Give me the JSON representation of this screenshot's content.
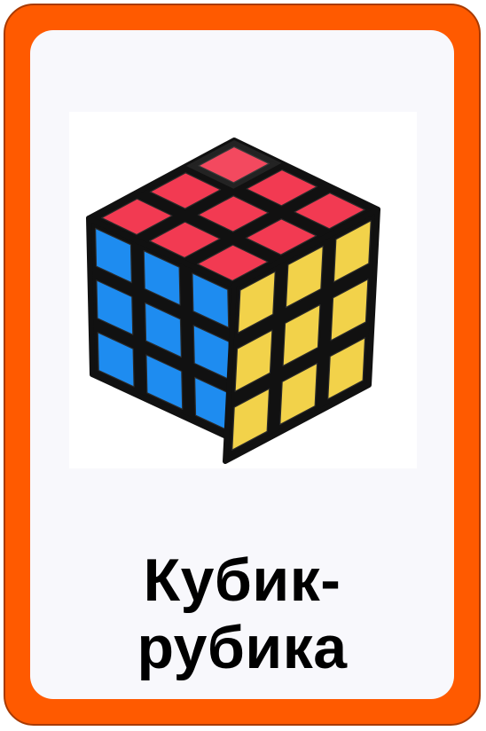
{
  "card": {
    "frame_color": "#ff5a00",
    "panel_color": "#f8f8fc",
    "title_line1": "Кубик-",
    "title_line2": "рубика"
  },
  "image": {
    "icon": "rubiks-cube-icon",
    "face_colors": {
      "top": "#f23a52",
      "left": "#1e8cf0",
      "right": "#f2d24a"
    }
  }
}
